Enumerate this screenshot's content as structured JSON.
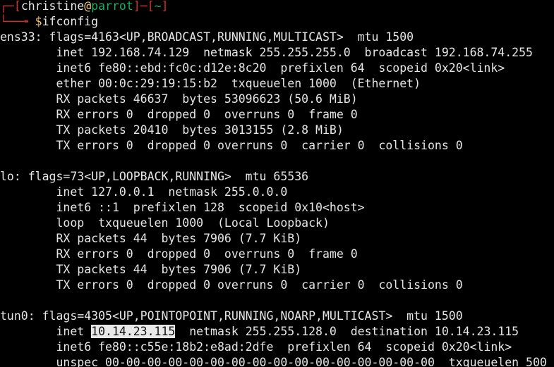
{
  "colors": {
    "background": "#000000",
    "text": "#e6e6e6",
    "prompt_frame": "#d2312b",
    "prompt_host": "#18b25e",
    "prompt_symbol": "#f0c674",
    "highlight_bg": "#e8e8e8"
  },
  "prompt": {
    "top_left": "┌─[",
    "user": "christine",
    "at": "@",
    "host": "parrot",
    "sep": "]─[",
    "cwd": "~",
    "close": "]",
    "bottom_left": "└──╼ ",
    "symbol": "$",
    "command": "ifconfig"
  },
  "output": {
    "l01": "ens33: flags=4163<UP,BROADCAST,RUNNING,MULTICAST>  mtu 1500",
    "l02": "        inet 192.168.74.129  netmask 255.255.255.0  broadcast 192.168.74.255",
    "l03": "        inet6 fe80::ebd:fc0c:d12e:8c20  prefixlen 64  scopeid 0x20<link>",
    "l04": "        ether 00:0c:29:19:15:b2  txqueuelen 1000  (Ethernet)",
    "l05": "        RX packets 46637  bytes 53096623 (50.6 MiB)",
    "l06": "        RX errors 0  dropped 0  overruns 0  frame 0",
    "l07": "        TX packets 20410  bytes 3013155 (2.8 MiB)",
    "l08": "        TX errors 0  dropped 0 overruns 0  carrier 0  collisions 0",
    "l09": "lo: flags=73<UP,LOOPBACK,RUNNING>  mtu 65536",
    "l10": "        inet 127.0.0.1  netmask 255.0.0.0",
    "l11": "        inet6 ::1  prefixlen 128  scopeid 0x10<host>",
    "l12": "        loop  txqueuelen 1000  (Local Loopback)",
    "l13": "        RX packets 44  bytes 7906 (7.7 KiB)",
    "l14": "        RX errors 0  dropped 0  overruns 0  frame 0",
    "l15": "        TX packets 44  bytes 7906 (7.7 KiB)",
    "l16": "        TX errors 0  dropped 0 overruns 0  carrier 0  collisions 0",
    "l17": "tun0: flags=4305<UP,POINTOPOINT,RUNNING,NOARP,MULTICAST>  mtu 1500",
    "l18_pre": "        inet ",
    "l18_ip": "10.14.23.115",
    "l18_post": "  netmask 255.255.128.0  destination 10.14.23.115",
    "l19": "        inet6 fe80::c55e:18b2:e8ad:2dfe  prefixlen 64  scopeid 0x20<link>",
    "l20": "        unspec 00-00-00-00-00-00-00-00-00-00-00-00-00-00-00-00  txqueuelen 500"
  }
}
